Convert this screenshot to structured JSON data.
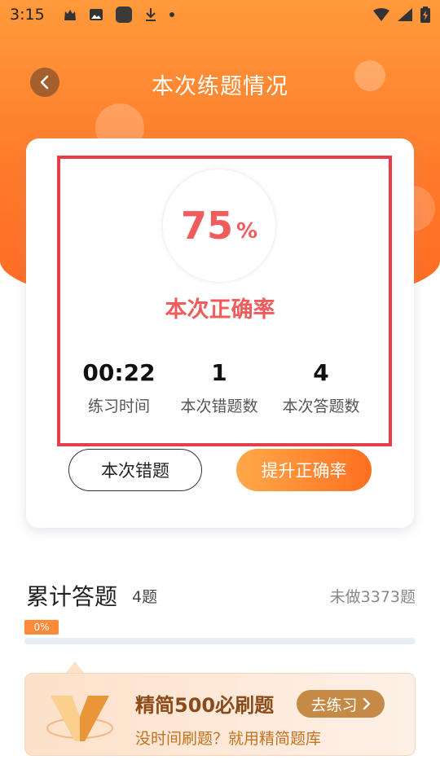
{
  "status_bar": {
    "time": "3:15"
  },
  "header": {
    "title": "本次练题情况"
  },
  "result": {
    "score": "75",
    "score_unit": "%",
    "accuracy_label": "本次正确率",
    "stats": [
      {
        "value": "00:22",
        "label": "练习时间"
      },
      {
        "value": "1",
        "label": "本次错题数"
      },
      {
        "value": "4",
        "label": "本次答题数"
      }
    ],
    "wrong_button": "本次错题",
    "improve_button": "提升正确率"
  },
  "cumulative": {
    "title": "累计答题",
    "count": "4题",
    "undone": "未做3373题",
    "progress_label": "0%",
    "progress": 0
  },
  "promo": {
    "title": "精简500必刷题",
    "subtitle": "没时间刷题？就用精简题库",
    "button": "去练习"
  },
  "colors": {
    "accent_orange": "#ff7a2a",
    "accuracy_red": "#f05b5b",
    "highlight_frame": "#e5404a"
  }
}
